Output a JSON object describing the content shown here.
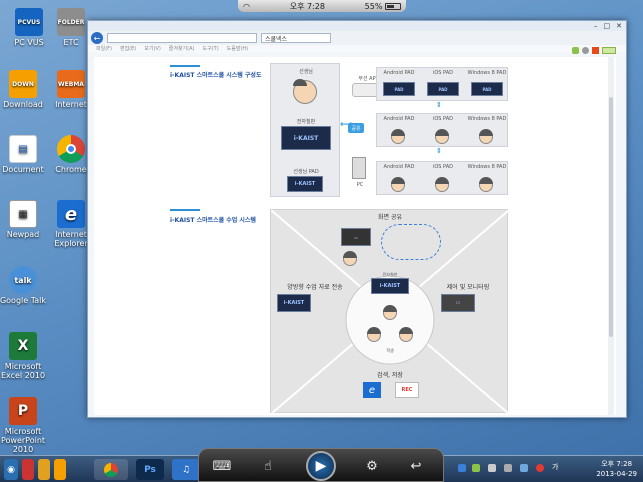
{
  "status": {
    "time": "오후 7:28",
    "battery": "55%",
    "battery_level": 0.55
  },
  "desktop_icons": [
    {
      "label": "PC VUS",
      "badge": "PCVUS",
      "color": "#1565c0"
    },
    {
      "label": "ETC",
      "badge": "FOLDER",
      "color": "#8d8d8d"
    },
    {
      "label": "Download",
      "badge": "DOWN",
      "color": "#f5a000"
    },
    {
      "label": "Internet",
      "badge": "WEBMA",
      "color": "#e86a1a"
    },
    {
      "label": "Document",
      "badge": "",
      "color": "#ffffff"
    },
    {
      "label": "Chrome",
      "badge": "",
      "color": "#ffffff"
    },
    {
      "label": "Newpad",
      "badge": "",
      "color": "#ffffff"
    },
    {
      "label": "Internet Explorer",
      "badge": "e",
      "color": "#1b6dd0"
    },
    {
      "label": "Google Talk",
      "badge": "talk",
      "color": "#4a90d9"
    },
    {
      "label": "Microsoft Excel 2010",
      "badge": "X",
      "color": "#1d7a3a"
    },
    {
      "label": "Microsoft PowerPoint 2010",
      "badge": "P",
      "color": "#c8441a"
    }
  ],
  "browser": {
    "address": "",
    "tab_label": "스쿨넥스",
    "menu": [
      "파일(F)",
      "편집(E)",
      "보기(V)",
      "즐겨찾기(A)",
      "도구(T)",
      "도움말(H)"
    ],
    "section1": {
      "title": "i-KAIST 스마트스쿨 시스템 구성도",
      "teacher": "선생님",
      "pen": "전자칠판",
      "kaist": "i-KAIST",
      "teacher_pad": "선생님 PAD",
      "ap": "무선 AP",
      "share": "공유",
      "pc": "PC",
      "rows": [
        [
          "Android PAD",
          "iOS PAD",
          "Windows 8 PAD"
        ],
        [
          "Android PAD",
          "iOS PAD",
          "Windows 8 PAD"
        ],
        [
          "Android PAD",
          "iOS PAD",
          "Windows 8 PAD"
        ]
      ]
    },
    "section2": {
      "title": "i-KAIST 스마트스쿨 수업 시스템",
      "screen_share": "화면 공유",
      "two_way": "양방향 수업 자료 전송",
      "control": "제어 및 모니터링",
      "search": "검색, 저장",
      "center": "전자칠판",
      "student": "학생",
      "rec": "REC"
    }
  },
  "taskbar": {
    "items": [
      "Chrome",
      "Photoshop",
      "iTunes"
    ],
    "clock_time": "오후 7:28",
    "clock_date": "2013-04-29",
    "lang": "가"
  },
  "dock": {
    "buttons": [
      "keyboard-icon",
      "touch-icon",
      "play-icon",
      "gear-icon",
      "back-icon"
    ]
  }
}
